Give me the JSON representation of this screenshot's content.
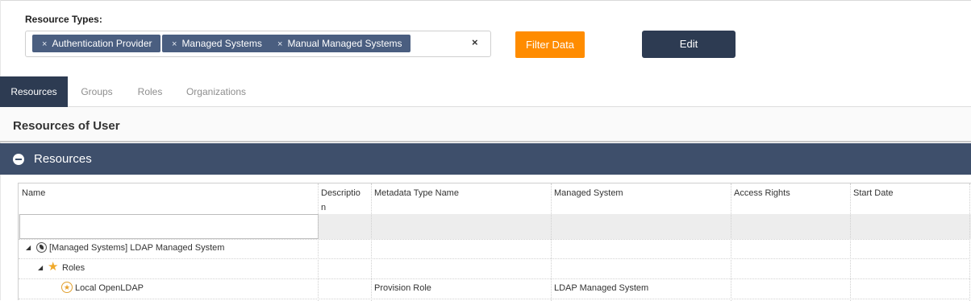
{
  "filter": {
    "label": "Resource Types:",
    "tags": [
      {
        "text": "Authentication Provider",
        "remove": "×"
      },
      {
        "text": "Managed Systems",
        "remove": "×"
      },
      {
        "text": "Manual Managed Systems",
        "remove": "×"
      }
    ],
    "clear": "×"
  },
  "buttons": {
    "filter_data": "Filter Data",
    "edit": "Edit"
  },
  "colors": {
    "tag_bg": "#4a5e80",
    "filter_button": "#ff8c00",
    "edit_button": "#2d3b52",
    "active_tab": "#2d3b52",
    "panel_header": "#3e4f6b"
  },
  "tabs": [
    {
      "label": "Resources",
      "active": true
    },
    {
      "label": "Groups",
      "active": false
    },
    {
      "label": "Roles",
      "active": false
    },
    {
      "label": "Organizations",
      "active": false
    }
  ],
  "section_title": "Resources of User",
  "panel": {
    "title": "Resources",
    "icon": "collapse-minus-icon"
  },
  "grid": {
    "columns": [
      "Name",
      "Descriptio\nn",
      "Metadata Type Name",
      "Managed System",
      "Access Rights",
      "Start Date"
    ],
    "rows": [
      {
        "name": "[Managed Systems] LDAP Managed System",
        "icon": "managed-system-icon",
        "expanded": true,
        "description": "",
        "metadata_type": "",
        "managed_system": "",
        "access_rights": "",
        "start_date": ""
      },
      {
        "name": "Roles",
        "icon": "star-icon",
        "expanded": true,
        "description": "",
        "metadata_type": "",
        "managed_system": "",
        "access_rights": "",
        "start_date": ""
      },
      {
        "name": "Local OpenLDAP",
        "icon": "role-star-icon",
        "description": "",
        "metadata_type": "Provision Role",
        "managed_system": "LDAP Managed System",
        "access_rights": "",
        "start_date": ""
      }
    ]
  }
}
